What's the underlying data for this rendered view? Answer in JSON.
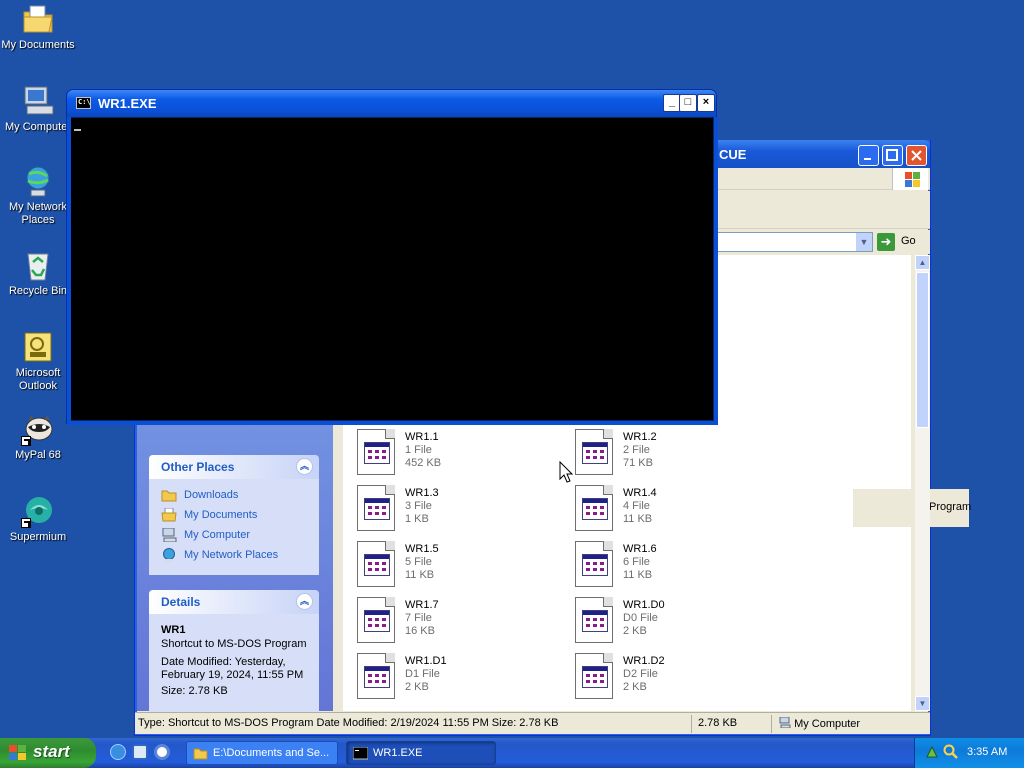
{
  "desktop": {
    "icons": [
      {
        "label": "My Documents"
      },
      {
        "label": "My Computer"
      },
      {
        "label": "My Network Places"
      },
      {
        "label": "Recycle Bin"
      },
      {
        "label": "Microsoft Outlook"
      },
      {
        "label": "MyPal 68"
      },
      {
        "label": "Supermium"
      }
    ]
  },
  "cmd_window": {
    "title": "WR1.EXE",
    "icon_text": "C:\\",
    "minimize": "_",
    "maximize": "□",
    "close": "×"
  },
  "explorer": {
    "title_visible": "CUE",
    "address": {
      "go_label": "Go"
    },
    "program_tile_label": "Program",
    "other_places": {
      "title": "Other Places",
      "items": [
        {
          "label": "Downloads"
        },
        {
          "label": "My Documents"
        },
        {
          "label": "My Computer"
        },
        {
          "label": "My Network Places"
        }
      ]
    },
    "details": {
      "title": "Details",
      "name": "WR1",
      "type": "Shortcut to MS-DOS Program",
      "modified": "Date Modified: Yesterday, February 19, 2024, 11:55 PM",
      "size": "Size: 2.78 KB"
    },
    "files": [
      {
        "name": "WR1.1",
        "type": "1 File",
        "size": "452 KB"
      },
      {
        "name": "WR1.2",
        "type": "2 File",
        "size": "71 KB"
      },
      {
        "name": "WR1.3",
        "type": "3 File",
        "size": "1 KB"
      },
      {
        "name": "WR1.4",
        "type": "4 File",
        "size": "11 KB"
      },
      {
        "name": "WR1.5",
        "type": "5 File",
        "size": "11 KB"
      },
      {
        "name": "WR1.6",
        "type": "6 File",
        "size": "11 KB"
      },
      {
        "name": "WR1.7",
        "type": "7 File",
        "size": "16 KB"
      },
      {
        "name": "WR1.D0",
        "type": "D0 File",
        "size": "2 KB"
      },
      {
        "name": "WR1.D1",
        "type": "D1 File",
        "size": "2 KB"
      },
      {
        "name": "WR1.D2",
        "type": "D2 File",
        "size": "2 KB"
      }
    ],
    "status": {
      "description": "Type: Shortcut to MS-DOS Program Date Modified: 2/19/2024 11:55 PM Size: 2.78 KB",
      "size": "2.78 KB",
      "zone": "My Computer"
    }
  },
  "taskbar": {
    "start_label": "start",
    "tasks": [
      {
        "label": "E:\\Documents and Se..."
      },
      {
        "label": "WR1.EXE"
      }
    ],
    "clock": "3:35 AM"
  }
}
